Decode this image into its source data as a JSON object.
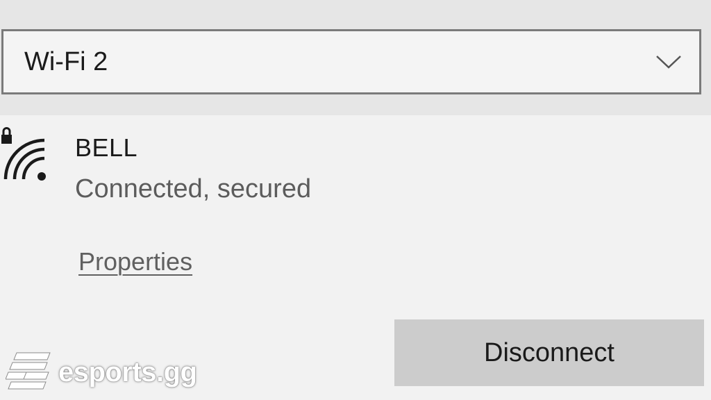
{
  "adapter_selector": {
    "selected_value": "Wi-Fi 2",
    "dropdown_icon": "chevron-down-icon"
  },
  "network": {
    "name": "BELL",
    "status": "Connected, secured",
    "icon": "wifi-secured-icon",
    "properties_link": "Properties"
  },
  "actions": {
    "disconnect_label": "Disconnect"
  },
  "watermark": {
    "text": "esports.gg"
  },
  "colors": {
    "band_background": "#e6e6e6",
    "panel_background": "#f2f2f2",
    "select_border": "#7a7a7a",
    "button_background": "#cccccc",
    "secondary_text": "#5c5c5c"
  }
}
